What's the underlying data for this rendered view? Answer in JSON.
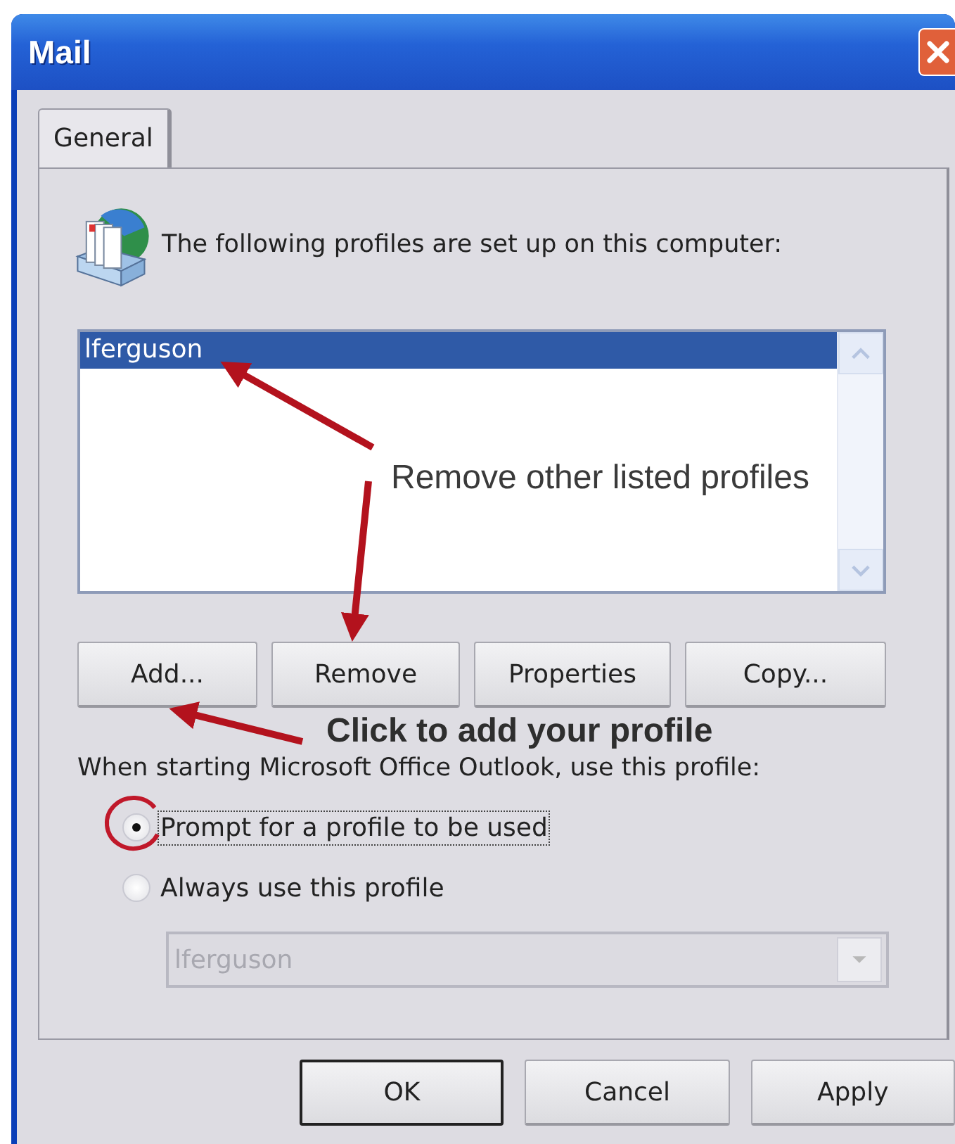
{
  "window": {
    "title": "Mail"
  },
  "tabs": [
    {
      "label": "General",
      "selected": true
    }
  ],
  "header": {
    "text": "The following profiles are set up on this computer:"
  },
  "profiles": {
    "items": [
      {
        "label": "lferguson",
        "selected": true
      }
    ]
  },
  "profile_buttons": [
    {
      "label": "Add..."
    },
    {
      "label": "Remove"
    },
    {
      "label": "Properties"
    },
    {
      "label": "Copy..."
    }
  ],
  "startup": {
    "label": "When starting Microsoft Office Outlook, use this profile:",
    "options": [
      {
        "label": "Prompt for a profile to be used",
        "selected": true,
        "focused": true
      },
      {
        "label": "Always use this profile",
        "selected": false,
        "focused": false
      }
    ],
    "profile_select": {
      "value": "lferguson",
      "disabled": true
    }
  },
  "dialog_buttons": [
    {
      "label": "OK",
      "default": true
    },
    {
      "label": "Cancel",
      "default": false
    },
    {
      "label": "Apply",
      "default": false
    }
  ],
  "annotations": [
    {
      "text": "Remove other listed profiles",
      "kind": "plain"
    },
    {
      "text": "Click to add your profile",
      "kind": "bold"
    }
  ]
}
